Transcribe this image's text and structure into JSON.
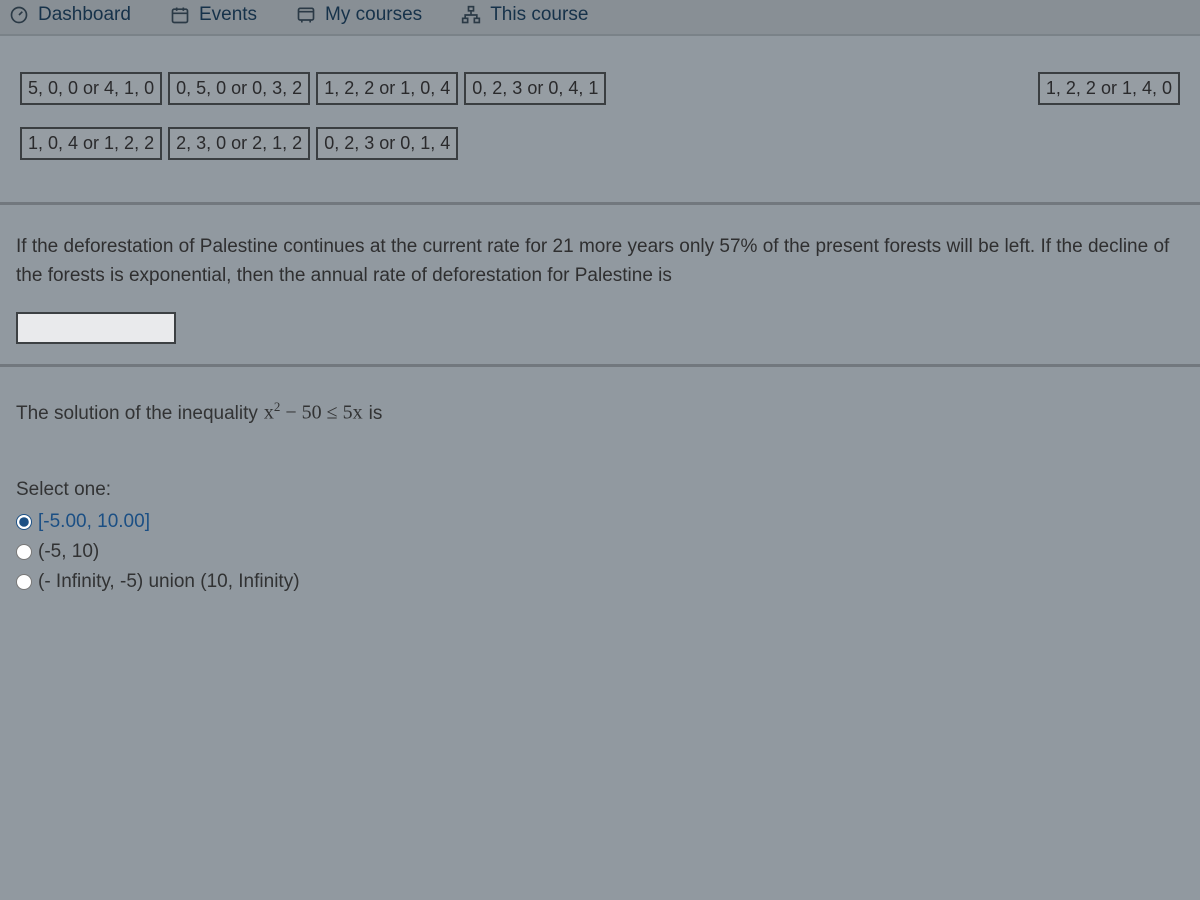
{
  "nav": {
    "dashboard": "Dashboard",
    "events": "Events",
    "my_courses": "My courses",
    "this_course": "This course"
  },
  "chips": {
    "row1": {
      "c1": "5, 0, 0 or 4, 1, 0",
      "c2": "0, 5, 0 or 0, 3, 2",
      "c3": "1, 2, 2 or 1, 0, 4",
      "c4": "0, 2, 3 or 0, 4, 1",
      "c5": "1, 2, 2 or 1, 4, 0"
    },
    "row2": {
      "c1": "1, 0, 4 or 1, 2, 2",
      "c2": "2, 3, 0 or 2, 1, 2",
      "c3": "0, 2, 3 or 0, 1, 4"
    }
  },
  "q2": {
    "text": "If the deforestation of Palestine continues at the current rate for 21 more years only 57% of the present forests will be left. If the decline of the forests is exponential, then the annual rate of deforestation for Palestine is",
    "answer_value": ""
  },
  "q3": {
    "prefix": "The solution of the inequality",
    "math_plain": "x² − 50 ≤ 5x",
    "suffix": "is",
    "select_label": "Select one:",
    "options": {
      "a": "[-5.00, 10.00]",
      "b": "(-5, 10)",
      "c": "(- Infinity, -5) union (10, Infinity)"
    },
    "selected": "a"
  }
}
